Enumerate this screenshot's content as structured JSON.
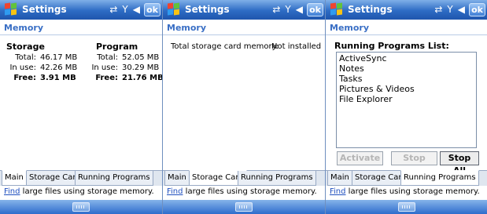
{
  "window": {
    "title": "Settings",
    "ok_label": "ok"
  },
  "panels": [
    {
      "header": "Memory",
      "storage": {
        "heading": "Storage",
        "rows": [
          {
            "label": "Total:",
            "value": "46.17 MB"
          },
          {
            "label": "In use:",
            "value": "42.26 MB"
          },
          {
            "label": "Free:",
            "value": "3.91 MB"
          }
        ]
      },
      "program": {
        "heading": "Program",
        "rows": [
          {
            "label": "Total:",
            "value": "52.05 MB"
          },
          {
            "label": "In use:",
            "value": "30.29 MB"
          },
          {
            "label": "Free:",
            "value": "21.76 MB"
          }
        ]
      }
    },
    {
      "header": "Memory",
      "card_label": "Total storage card memory:",
      "card_value": "Not installed"
    },
    {
      "header": "Memory",
      "list_title": "Running Programs List:",
      "programs": [
        "ActiveSync",
        "Notes",
        "Tasks",
        "Pictures & Videos",
        "File Explorer"
      ],
      "buttons": {
        "activate": "Activate",
        "stop": "Stop",
        "stop_all": "Stop All"
      }
    }
  ],
  "tabs": [
    "Main",
    "Storage Card",
    "Running Programs"
  ],
  "find": {
    "link": "Find",
    "rest": " large files using storage memory."
  },
  "icons": {
    "connectivity": "sync-arrows-icon",
    "signal": "antenna-icon",
    "volume": "speaker-icon",
    "start": "windows-logo-icon",
    "keyboard": "keyboard-icon"
  }
}
